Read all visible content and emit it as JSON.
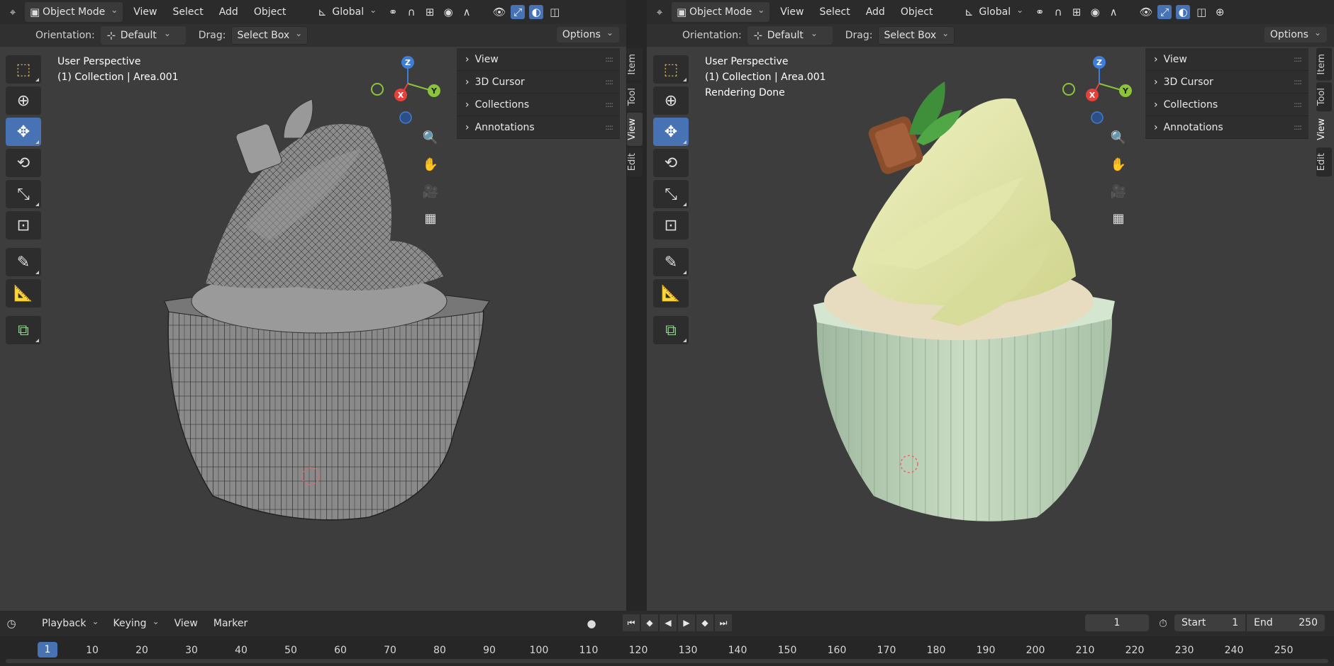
{
  "left": {
    "header": {
      "mode": "Object Mode",
      "menus": [
        "View",
        "Select",
        "Add",
        "Object"
      ],
      "transform_orientation": "Global"
    },
    "tool_header": {
      "orientation_label": "Orientation:",
      "orientation_value": "Default",
      "drag_label": "Drag:",
      "drag_value": "Select Box",
      "options": "Options"
    },
    "overlay": {
      "line1": "User Perspective",
      "line2": "(1) Collection | Area.001"
    },
    "npanel": [
      "View",
      "3D Cursor",
      "Collections",
      "Annotations"
    ],
    "tabs": [
      "Item",
      "Tool",
      "View",
      "Edit"
    ]
  },
  "right": {
    "header": {
      "mode": "Object Mode",
      "menus": [
        "View",
        "Select",
        "Add",
        "Object"
      ],
      "transform_orientation": "Global"
    },
    "tool_header": {
      "orientation_label": "Orientation:",
      "orientation_value": "Default",
      "drag_label": "Drag:",
      "drag_value": "Select Box",
      "options": "Options"
    },
    "overlay": {
      "line1": "User Perspective",
      "line2": "(1) Collection | Area.001",
      "line3": "Rendering Done"
    },
    "npanel": [
      "View",
      "3D Cursor",
      "Collections",
      "Annotations"
    ],
    "tabs": [
      "Item",
      "Tool",
      "View",
      "Edit"
    ]
  },
  "gizmo": {
    "x": "X",
    "y": "Y",
    "z": "Z"
  },
  "timeline": {
    "menus": [
      "Playback",
      "Keying",
      "View",
      "Marker"
    ],
    "current_frame": "1",
    "start_label": "Start",
    "start_value": "1",
    "end_label": "End",
    "end_value": "250",
    "ruler_current": "1",
    "ruler_ticks": [
      "10",
      "20",
      "30",
      "40",
      "50",
      "60",
      "70",
      "80",
      "90",
      "100",
      "110",
      "120",
      "130",
      "140",
      "150",
      "160",
      "170",
      "180",
      "190",
      "200",
      "210",
      "220",
      "230",
      "240",
      "250"
    ]
  },
  "colors": {
    "accent": "#4772b3",
    "axis_x": "#e6403a",
    "axis_y": "#8bc33a",
    "axis_z": "#3f7ed6"
  }
}
